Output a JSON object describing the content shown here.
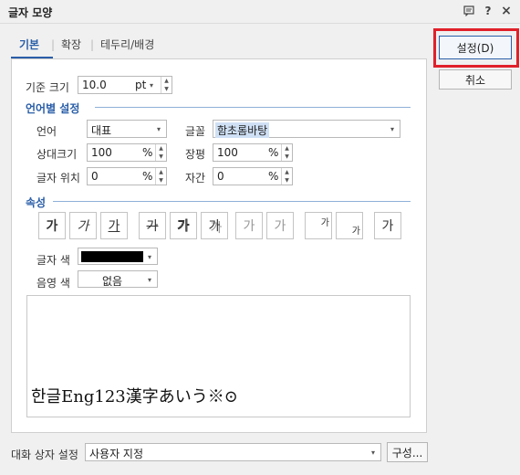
{
  "window": {
    "title": "글자 모양",
    "help_icon": "?",
    "close_icon": "×"
  },
  "tabs": {
    "basic": "기본",
    "extended": "확장",
    "border": "테두리/배경"
  },
  "base_size": {
    "label": "기준 크기",
    "value": "10.0",
    "unit": "pt"
  },
  "lang_section": {
    "title": "언어별 설정",
    "language_label": "언어",
    "language_value": "대표",
    "font_label": "글꼴",
    "font_value": "함초롬바탕",
    "rel_size_label": "상대크기",
    "rel_size_value": "100",
    "rel_size_unit": "%",
    "width_label": "장평",
    "width_value": "100",
    "width_unit": "%",
    "position_label": "글자 위치",
    "position_value": "0",
    "position_unit": "%",
    "spacing_label": "자간",
    "spacing_value": "0",
    "spacing_unit": "%"
  },
  "attr_section": {
    "title": "속성",
    "buttons": [
      "가",
      "가",
      "가",
      "가",
      "가",
      "가",
      "가",
      "가",
      "가",
      "가",
      "가"
    ],
    "text_color_label": "글자 색",
    "text_color": "#000000",
    "shade_color_label": "음영 색",
    "shade_color_value": "없음"
  },
  "preview": {
    "text": "한글Eng123漢字あいう※⊙"
  },
  "footer": {
    "label": "대화 상자 설정",
    "value": "사용자 지정",
    "config_button": "구성..."
  },
  "actions": {
    "ok": "설정(D)",
    "cancel": "취소"
  },
  "highlight_color": "#e0202a",
  "accent_color": "#2a5ea8"
}
